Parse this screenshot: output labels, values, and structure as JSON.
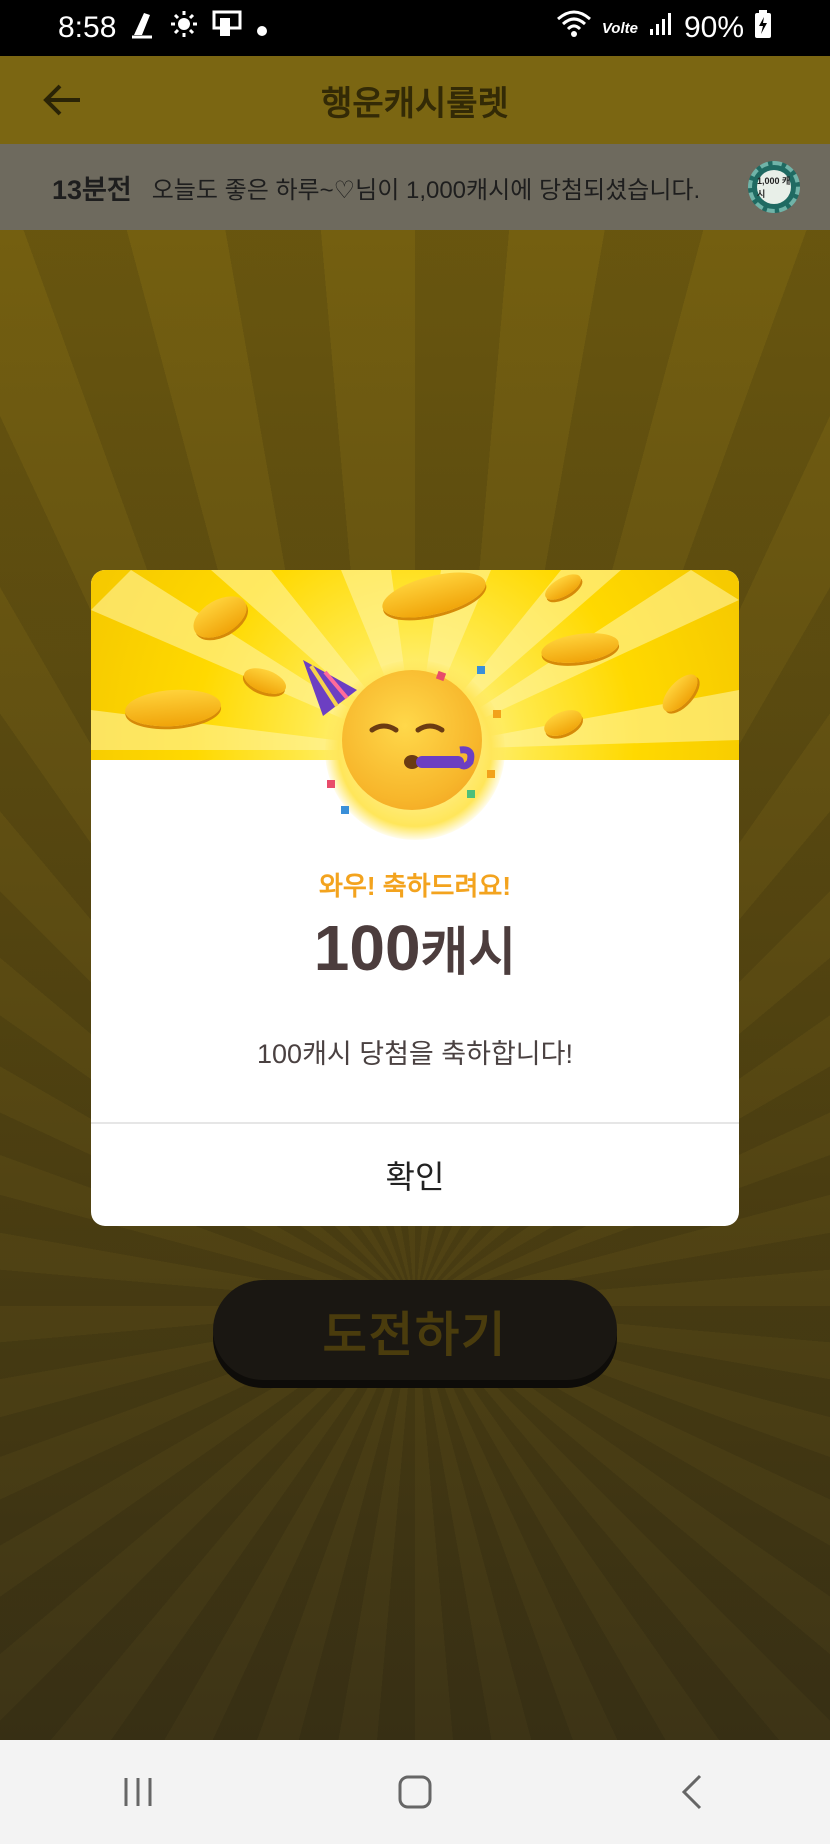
{
  "status_bar": {
    "time": "8:58",
    "network_label": "Volte",
    "battery": "90%"
  },
  "header": {
    "title": "행운캐시룰렛"
  },
  "ticker": {
    "time_ago": "13분전",
    "message": "오늘도 좋은 하루~♡님이 1,000캐시에 당첨되셨습니다.",
    "coin_label": "1,000 캐시"
  },
  "challenge_button": {
    "label": "도전하기"
  },
  "modal": {
    "congrats": "와우! 축하드려요!",
    "amount_number": "100",
    "amount_unit": "캐시",
    "message": "100캐시 당첨을 축하합니다!",
    "confirm_label": "확인"
  },
  "colors": {
    "accent": "#f3a31e",
    "header_bg": "#7b6612",
    "modal_top": "#ffd900",
    "amount_text": "#4c3d3d"
  },
  "icons": [
    "back-arrow-icon",
    "notification-icon",
    "brightness-icon",
    "screen-mirror-icon",
    "dot-icon",
    "wifi-icon",
    "signal-icon",
    "battery-charging-icon",
    "coin-icon",
    "party-face-emoji",
    "recent-apps-icon",
    "home-icon",
    "back-nav-icon"
  ]
}
